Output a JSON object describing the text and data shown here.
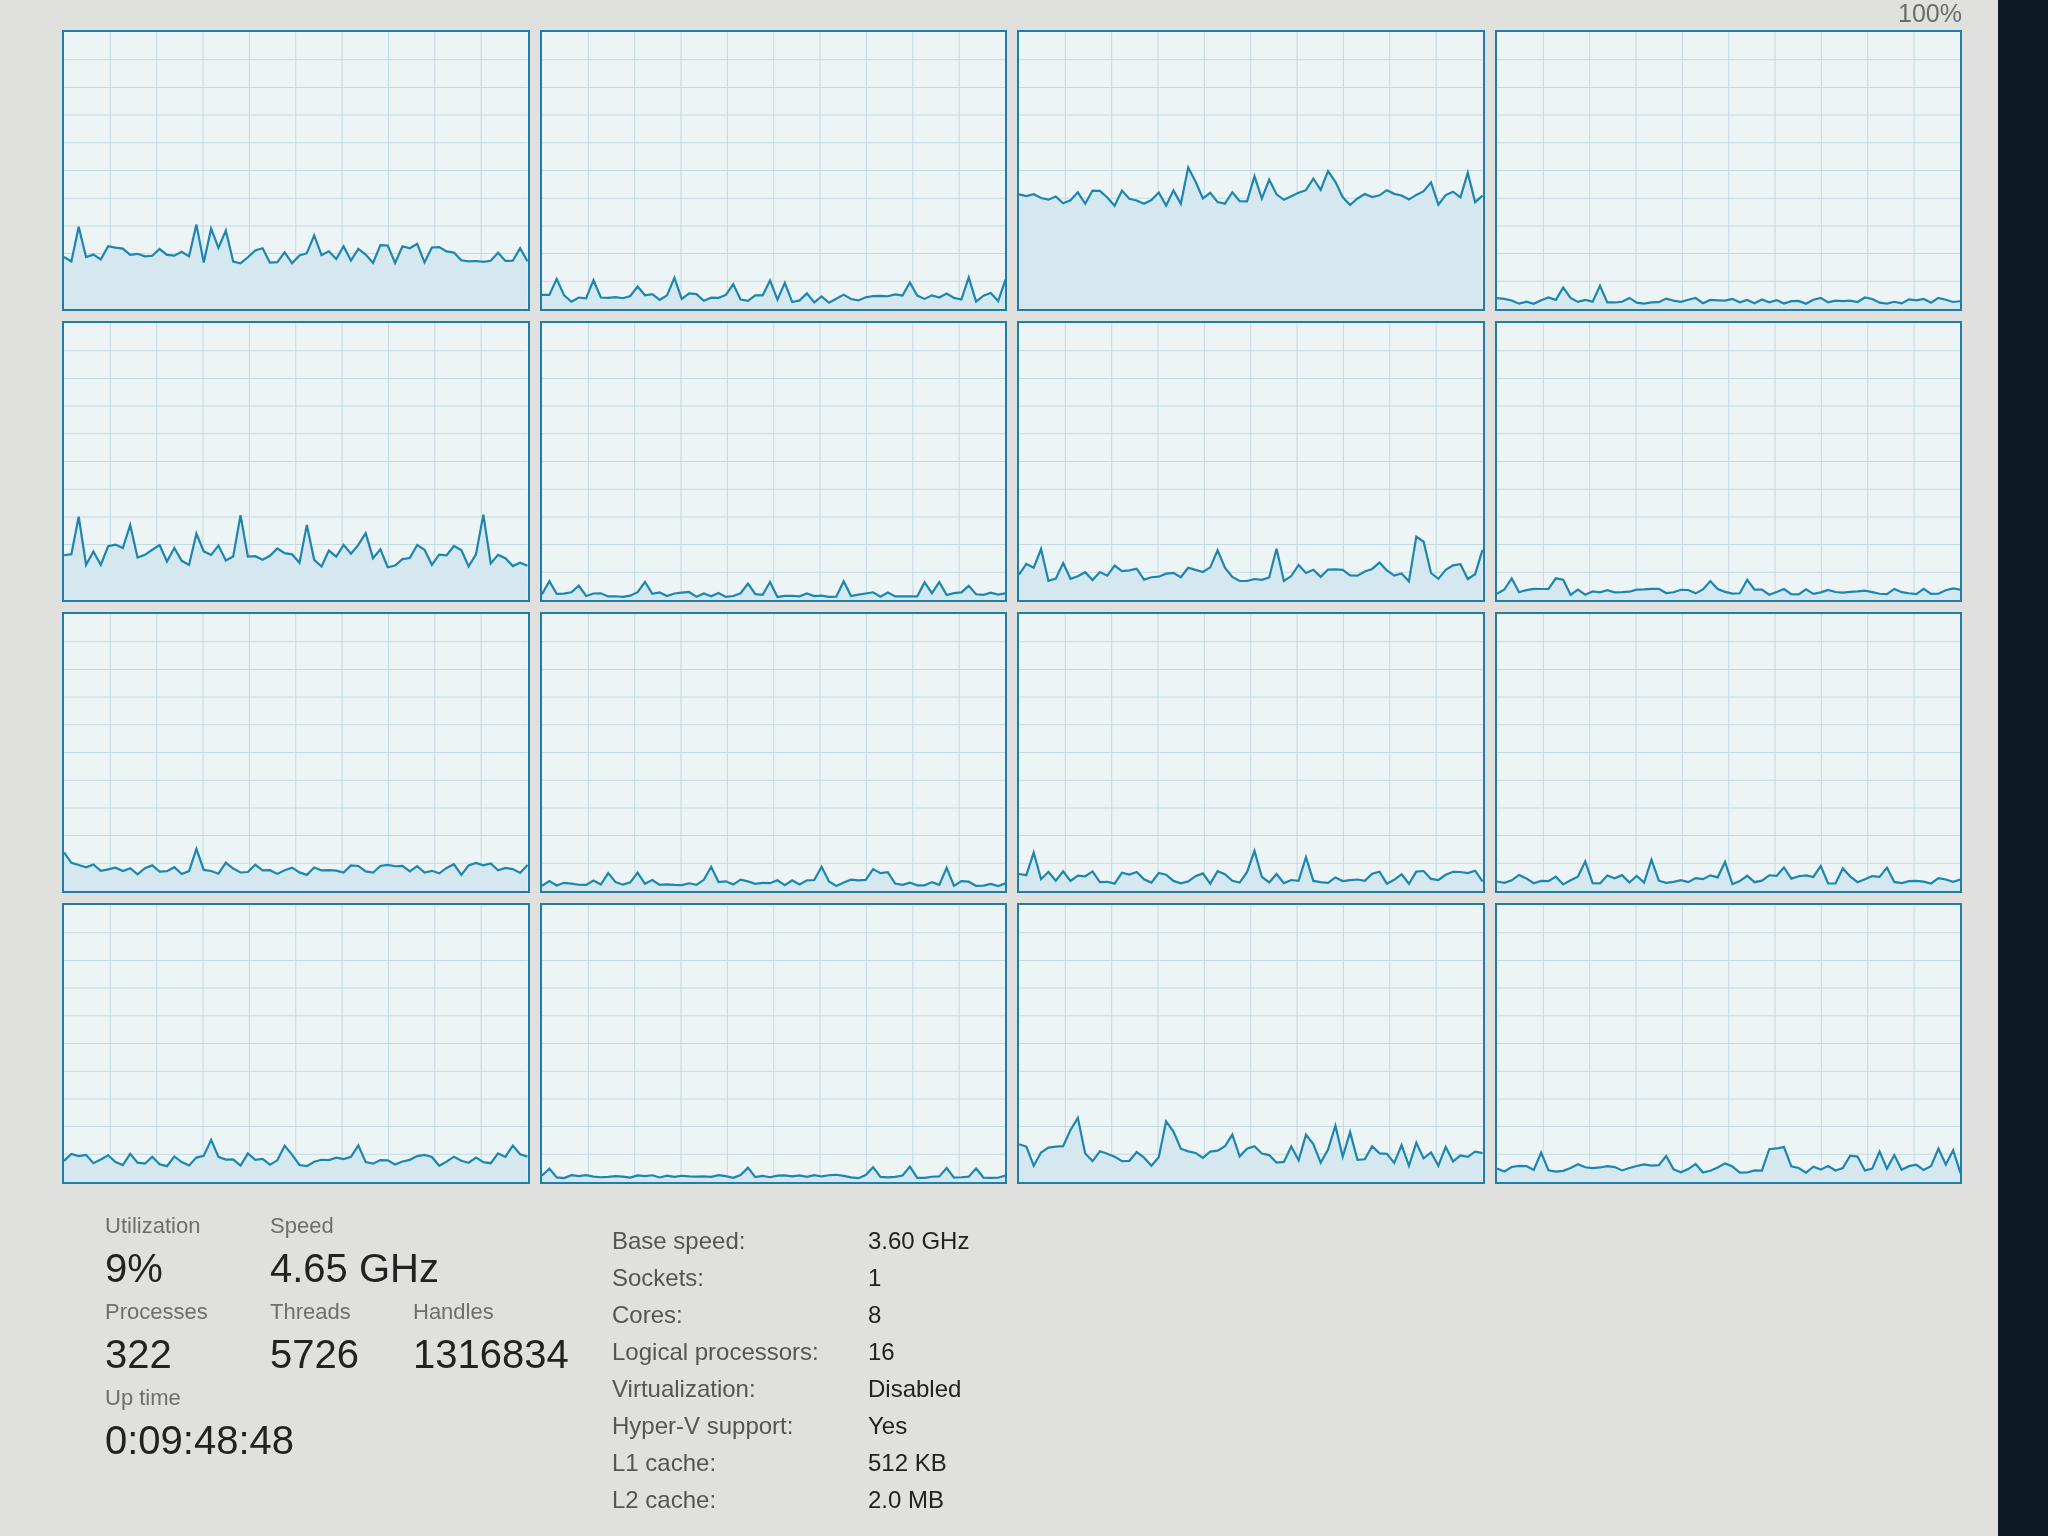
{
  "graph_scale": {
    "max_label": "100%"
  },
  "summary_rows": [
    {
      "stats": [
        {
          "label": "Utilization",
          "value": "9%"
        },
        {
          "label": "Speed",
          "value": "4.65 GHz"
        }
      ]
    },
    {
      "stats": [
        {
          "label": "Processes",
          "value": "322"
        },
        {
          "label": "Threads",
          "value": "5726"
        },
        {
          "label": "Handles",
          "value": "1316834"
        }
      ]
    },
    {
      "stats": [
        {
          "label": "Up time",
          "value": "0:09:48:48"
        }
      ]
    }
  ],
  "details": [
    {
      "label": "Base speed:",
      "value": "3.60 GHz"
    },
    {
      "label": "Sockets:",
      "value": "1"
    },
    {
      "label": "Cores:",
      "value": "8"
    },
    {
      "label": "Logical processors:",
      "value": "16"
    },
    {
      "label": "Virtualization:",
      "value": "Disabled"
    },
    {
      "label": "Hyper-V support:",
      "value": "Yes"
    },
    {
      "label": "L1 cache:",
      "value": "512 KB"
    },
    {
      "label": "L2 cache:",
      "value": "2.0 MB"
    }
  ]
}
